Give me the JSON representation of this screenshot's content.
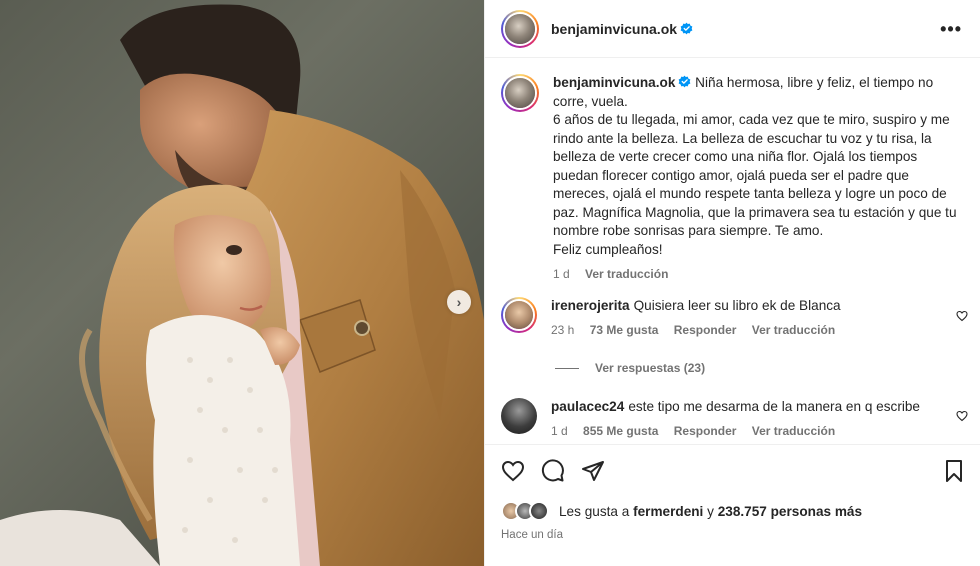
{
  "post": {
    "username": "benjaminvicuna.ok",
    "more_label": "•••"
  },
  "caption": {
    "username": "benjaminvicuna.ok",
    "text": "Niña hermosa, libre y feliz, el tiempo no corre, vuela.\n6 años de tu llegada, mi amor, cada vez que te miro, suspiro y me rindo ante la belleza. La belleza de escuchar tu voz y tu risa, la belleza de verte crecer como una niña flor. Ojalá los tiempos puedan florecer contigo amor, ojalá pueda ser el padre que mereces, ojalá el mundo respete tanta belleza y logre un poco de paz. Magnífica Magnolia, que la primavera sea tu estación y que tu nombre robe sonrisas para siempre. Te amo.\nFeliz cumpleaños!",
    "age": "1 d",
    "translate": "Ver traducción"
  },
  "comments": [
    {
      "username": "irenerojerita",
      "text": "Quisiera leer su libro ek de Blanca",
      "age": "23 h",
      "likes": "73 Me gusta",
      "reply": "Responder",
      "translate": "Ver traducción"
    },
    {
      "username": "paulacec24",
      "text": "este tipo me desarma de la manera en q escribe",
      "age": "1 d",
      "likes": "855 Me gusta",
      "reply": "Responder",
      "translate": "Ver traducción"
    }
  ],
  "view_replies": "Ver respuestas (23)",
  "likes_line": {
    "prefix": "Les gusta a",
    "user": "fermerdeni",
    "connector": "y",
    "others": "238.757 personas más"
  },
  "timestamp": "Hace un día",
  "colors": {
    "verified_blue": "#0095f6",
    "secondary_text": "#737373"
  },
  "icons": [
    "heart-icon",
    "comment-icon",
    "share-icon",
    "bookmark-icon",
    "chevron-right-icon",
    "more-icon",
    "verified-badge-icon"
  ]
}
